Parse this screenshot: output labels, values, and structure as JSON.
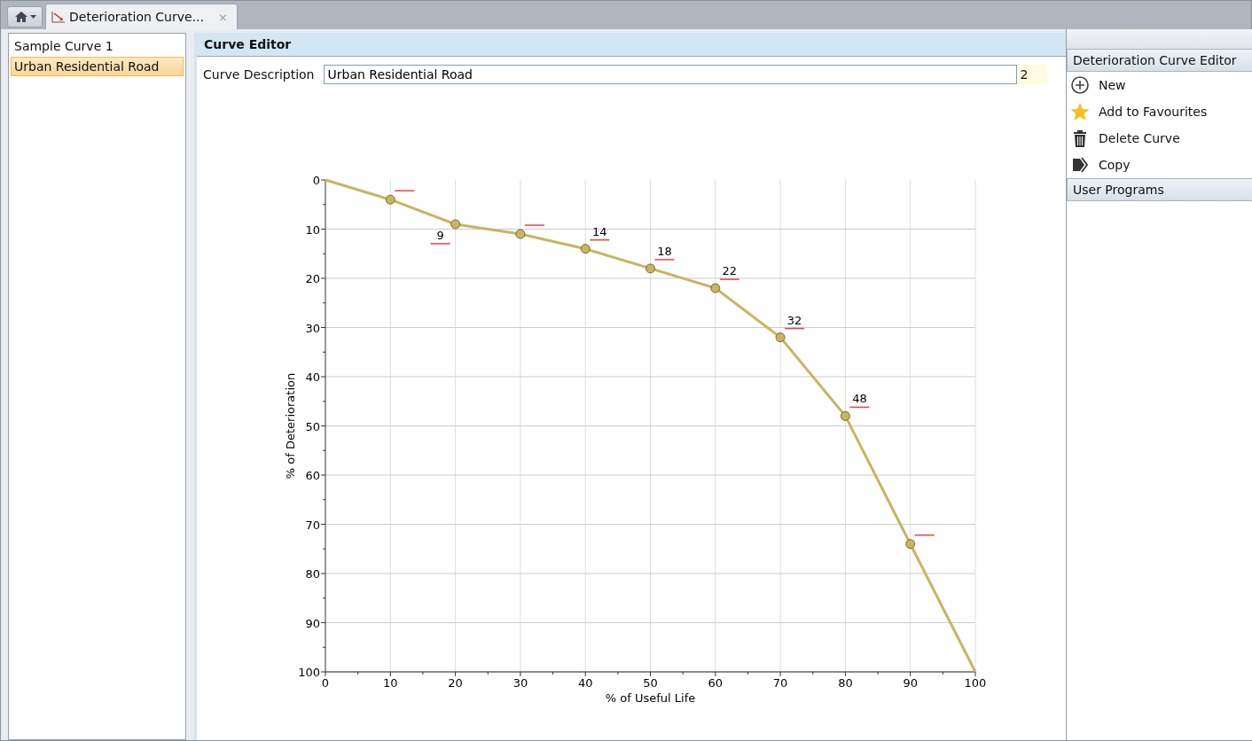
{
  "tabs": [
    {
      "label": "Deterioration Curve...",
      "selected": true,
      "close": "×"
    }
  ],
  "curves": [
    {
      "label": "Sample Curve 1",
      "selected": false
    },
    {
      "label": "Urban Residential Road",
      "selected": true
    }
  ],
  "editor": {
    "title": "Curve Editor",
    "description_label": "Curve Description",
    "description_value": "Urban Residential Road",
    "counter": "2",
    "chart_data": {
      "type": "line",
      "xlabel": "% of Useful Life",
      "ylabel": "% of Deterioration",
      "x": [
        0,
        10,
        20,
        30,
        40,
        50,
        60,
        70,
        80,
        90,
        100
      ],
      "series": [
        {
          "color": "#c8b560",
          "marker": "circle",
          "values": [
            0,
            4,
            9,
            11,
            14,
            18,
            22,
            32,
            48,
            74,
            100
          ]
        }
      ],
      "grid": true,
      "value_labels": [
        null,
        null,
        "9",
        null,
        "14",
        "18",
        "22",
        "32",
        "48",
        null,
        null
      ],
      "xlim": [
        0,
        100
      ],
      "ylim": [
        100,
        0
      ],
      "xticks": [
        0,
        10,
        20,
        30,
        40,
        50,
        60,
        70,
        80,
        90,
        100
      ],
      "yticks": [
        0,
        10,
        20,
        30,
        40,
        50,
        60,
        70,
        80,
        90,
        100
      ]
    }
  },
  "actions_panel": {
    "title": "Deterioration Curve Editor",
    "items": [
      {
        "label": "New",
        "kind": "new"
      },
      {
        "label": "Add to Favourites",
        "kind": "favourite"
      },
      {
        "label": "Delete Curve",
        "kind": "delete"
      },
      {
        "label": "Copy",
        "kind": "copy"
      }
    ]
  },
  "programs_panel": {
    "title": "User Programs"
  }
}
